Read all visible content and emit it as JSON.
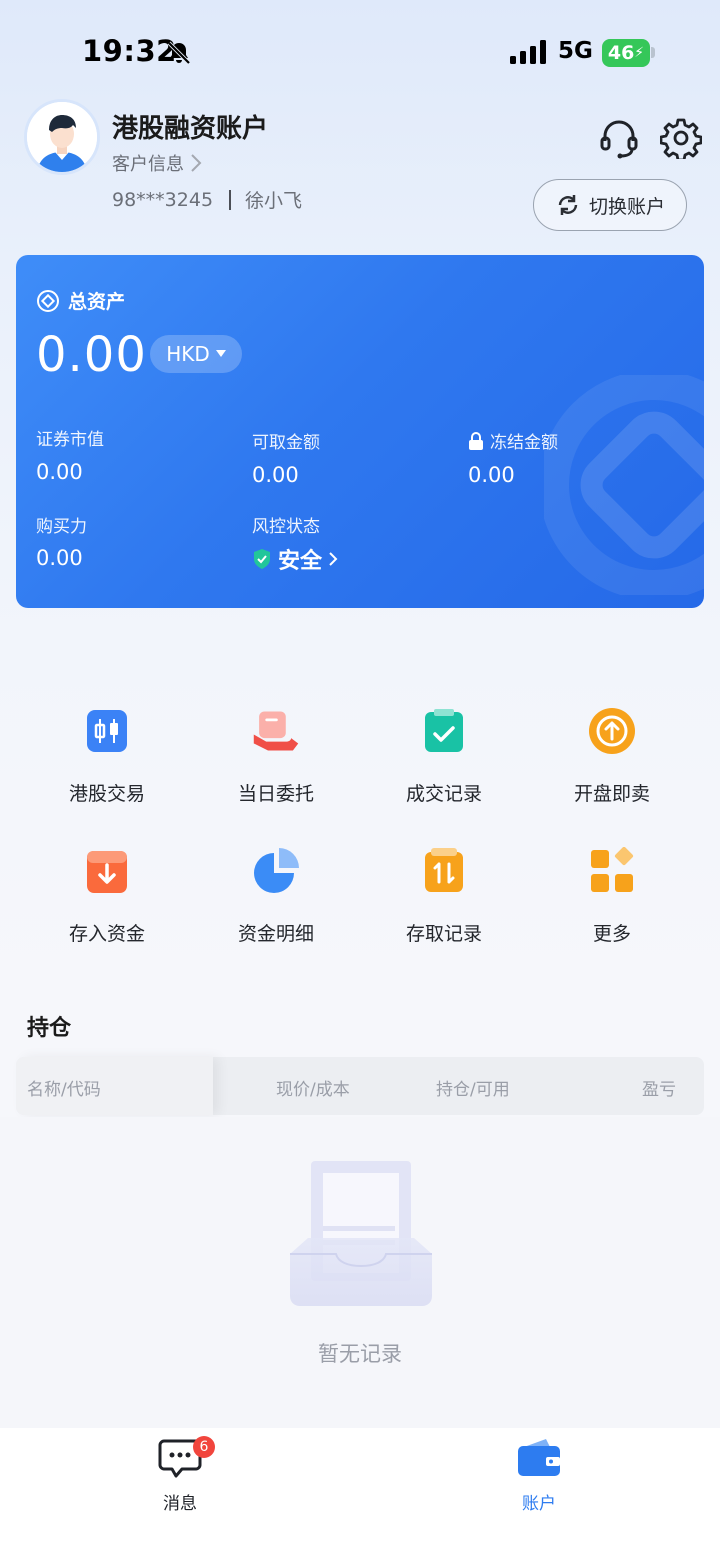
{
  "status_bar": {
    "time": "19:32",
    "network": "5G",
    "battery": "46"
  },
  "header": {
    "account_title": "港股融资账户",
    "customer_info": "客户信息",
    "account_number": "98***3245",
    "account_name": "徐小飞",
    "switch_account": "切换账户"
  },
  "assets": {
    "total_label": "总资产",
    "total_value": "0.00",
    "currency": "HKD",
    "metrics": [
      {
        "label": "证券市值",
        "value": "0.00"
      },
      {
        "label": "可取金额",
        "value": "0.00"
      },
      {
        "label": "冻结金额",
        "value": "0.00"
      },
      {
        "label": "购买力",
        "value": "0.00"
      }
    ],
    "risk_label": "风控状态",
    "risk_status": "安全"
  },
  "menu": [
    {
      "label": "港股交易",
      "icon": "candlestick-chart-icon",
      "color": "#3b82f6"
    },
    {
      "label": "当日委托",
      "icon": "hand-order-icon",
      "color": "#f04f47"
    },
    {
      "label": "成交记录",
      "icon": "clipboard-check-icon",
      "color": "#19c2a5"
    },
    {
      "label": "开盘即卖",
      "icon": "arrow-up-circle-icon",
      "color": "#f7a21b"
    },
    {
      "label": "存入资金",
      "icon": "deposit-icon",
      "color": "#fa6a3c"
    },
    {
      "label": "资金明细",
      "icon": "pie-chart-icon",
      "color": "#3b8cf6"
    },
    {
      "label": "存取记录",
      "icon": "transfer-record-icon",
      "color": "#f7a21b"
    },
    {
      "label": "更多",
      "icon": "more-grid-icon",
      "color": "#f7a21b"
    }
  ],
  "holdings": {
    "title": "持仓",
    "columns": [
      "名称/代码",
      "现价/成本",
      "持仓/可用",
      "盈亏"
    ],
    "empty_text": "暂无记录"
  },
  "tabbar": {
    "messages_label": "消息",
    "messages_badge": "6",
    "account_label": "账户"
  }
}
